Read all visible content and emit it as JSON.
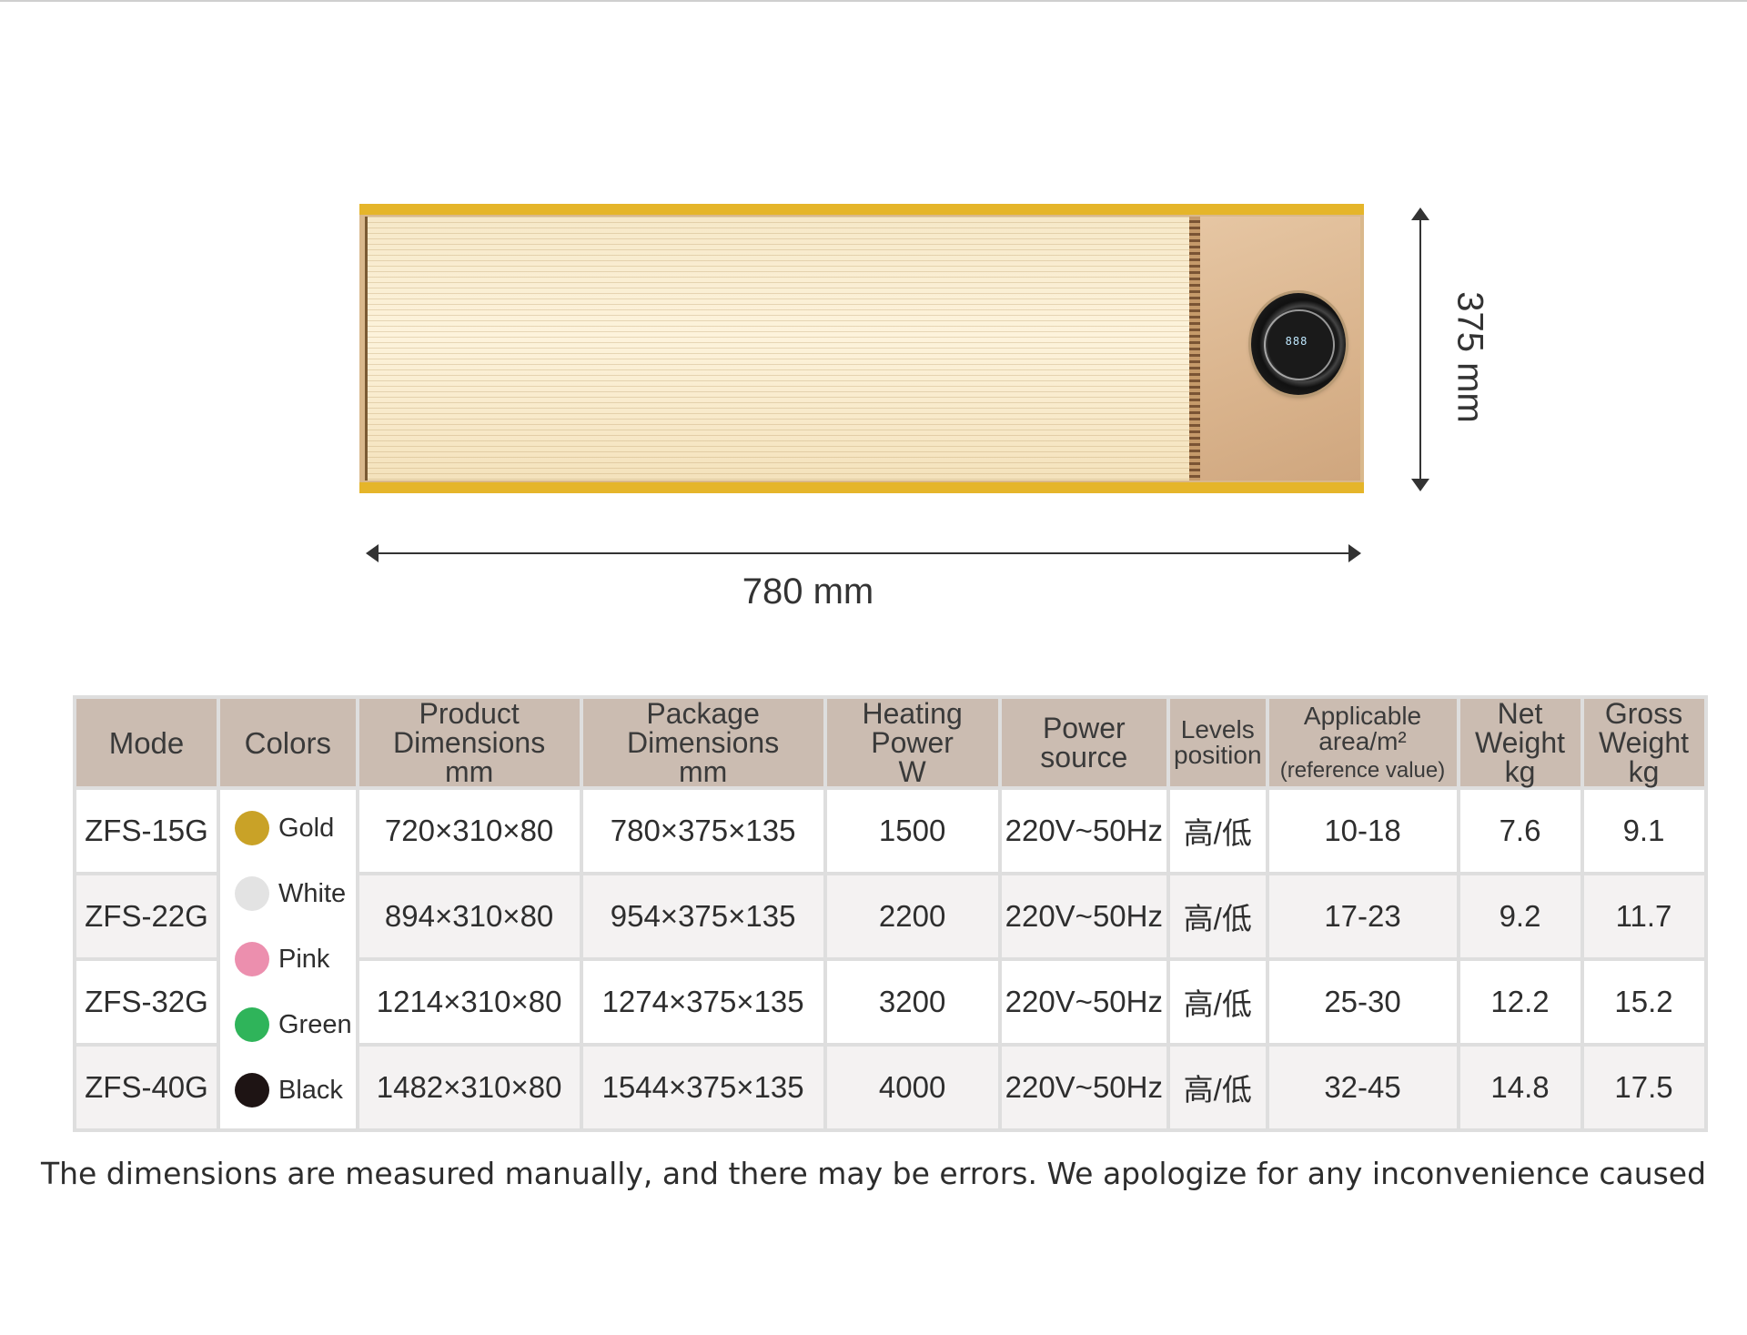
{
  "dimensions": {
    "width_label": "780 mm",
    "height_label": "375 mm"
  },
  "knob_display": "888",
  "table": {
    "headers": {
      "mode": "Mode",
      "colors": "Colors",
      "product_dim": [
        "Product",
        "Dimensions",
        "mm"
      ],
      "package_dim": [
        "Package",
        "Dimensions",
        "mm"
      ],
      "heating_power": [
        "Heating",
        "Power",
        "W"
      ],
      "power_source": [
        "Power",
        "source"
      ],
      "levels": [
        "Levels",
        "position"
      ],
      "area": [
        "Applicable area/m²",
        "(reference value)"
      ],
      "net_weight": [
        "Net",
        "Weight",
        "kg"
      ],
      "gross_weight": [
        "Gross",
        "Weight",
        "kg"
      ]
    },
    "colors": [
      {
        "label": "Gold",
        "hex": "#c9a227"
      },
      {
        "label": "White",
        "hex": "#e3e3e3"
      },
      {
        "label": "Pink",
        "hex": "#ec8fae"
      },
      {
        "label": "Green",
        "hex": "#2fb45a"
      },
      {
        "label": "Black",
        "hex": "#1e1414"
      }
    ],
    "rows": [
      {
        "mode": "ZFS-15G",
        "product_dim": "720×310×80",
        "package_dim": "780×375×135",
        "power": "1500",
        "source": "220V~50Hz",
        "levels": "高/低",
        "area": "10-18",
        "net": "7.6",
        "gross": "9.1"
      },
      {
        "mode": "ZFS-22G",
        "product_dim": "894×310×80",
        "package_dim": "954×375×135",
        "power": "2200",
        "source": "220V~50Hz",
        "levels": "高/低",
        "area": "17-23",
        "net": "9.2",
        "gross": "11.7"
      },
      {
        "mode": "ZFS-32G",
        "product_dim": "1214×310×80",
        "package_dim": "1274×375×135",
        "power": "3200",
        "source": "220V~50Hz",
        "levels": "高/低",
        "area": "25-30",
        "net": "12.2",
        "gross": "15.2"
      },
      {
        "mode": "ZFS-40G",
        "product_dim": "1482×310×80",
        "package_dim": "1544×375×135",
        "power": "4000",
        "source": "220V~50Hz",
        "levels": "高/低",
        "area": "32-45",
        "net": "14.8",
        "gross": "17.5"
      }
    ]
  },
  "disclaimer": "The dimensions are measured manually, and there may be errors. We apologize for any inconvenience caused"
}
